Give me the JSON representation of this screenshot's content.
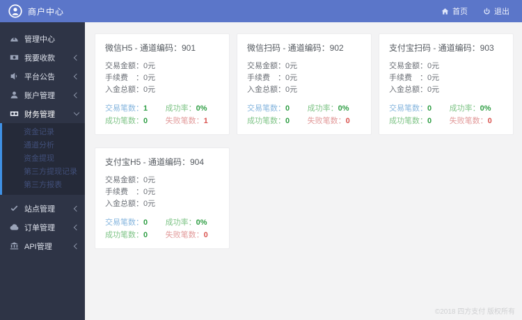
{
  "colors": {
    "header_bg": "#5b76c9",
    "sidebar_bg": "#2e3446",
    "submenu_accent": "#3f91e5",
    "stat_label_blue": "#85b5de",
    "stat_label_green": "#7fc487",
    "stat_label_red": "#e29a9a",
    "stat_value_green": "#2f9e44",
    "stat_value_red": "#d9534f"
  },
  "header": {
    "title": "商户中心",
    "nav": [
      {
        "label": "首页",
        "icon": "home-icon"
      },
      {
        "label": "退出",
        "icon": "logout-icon"
      }
    ]
  },
  "sidebar": {
    "items": [
      {
        "label": "管理中心",
        "icon": "dashboard-icon",
        "chevron": "none"
      },
      {
        "label": "我要收款",
        "icon": "collect-icon",
        "chevron": "left"
      },
      {
        "label": "平台公告",
        "icon": "announcement-icon",
        "chevron": "left"
      },
      {
        "label": "账户管理",
        "icon": "account-icon",
        "chevron": "left"
      },
      {
        "label": "财务管理",
        "icon": "finance-icon",
        "chevron": "down",
        "expanded": true,
        "children": [
          {
            "label": "资金记录"
          },
          {
            "label": "通道分析"
          },
          {
            "label": "资金提现"
          },
          {
            "label": "第三方提现记录"
          },
          {
            "label": "第三方报表"
          }
        ]
      },
      {
        "label": "站点管理",
        "icon": "site-icon",
        "chevron": "left"
      },
      {
        "label": "订单管理",
        "icon": "order-icon",
        "chevron": "left"
      },
      {
        "label": "API管理",
        "icon": "api-icon",
        "chevron": "left"
      }
    ]
  },
  "card_labels": {
    "amount": "交易金额：",
    "fee": "手续费　：",
    "deposit": "入金总额：",
    "tx_count": "交易笔数：",
    "success_rate": "成功率：",
    "success_count": "成功笔数：",
    "fail_count": "失败笔数："
  },
  "cards": [
    {
      "title": "微信H5 - 通道编码：901",
      "amount": "0元",
      "fee": "0元",
      "deposit": "0元",
      "tx_count": "1",
      "success_rate": "0%",
      "success_count": "0",
      "fail_count": "1"
    },
    {
      "title": "微信扫码 - 通道编码：902",
      "amount": "0元",
      "fee": "0元",
      "deposit": "0元",
      "tx_count": "0",
      "success_rate": "0%",
      "success_count": "0",
      "fail_count": "0"
    },
    {
      "title": "支付宝扫码 - 通道编码：903",
      "amount": "0元",
      "fee": "0元",
      "deposit": "0元",
      "tx_count": "0",
      "success_rate": "0%",
      "success_count": "0",
      "fail_count": "0"
    },
    {
      "title": "支付宝H5 - 通道编码：904",
      "amount": "0元",
      "fee": "0元",
      "deposit": "0元",
      "tx_count": "0",
      "success_rate": "0%",
      "success_count": "0",
      "fail_count": "0"
    }
  ],
  "footer": {
    "copyright": "©2018 四方支付 版权所有"
  }
}
